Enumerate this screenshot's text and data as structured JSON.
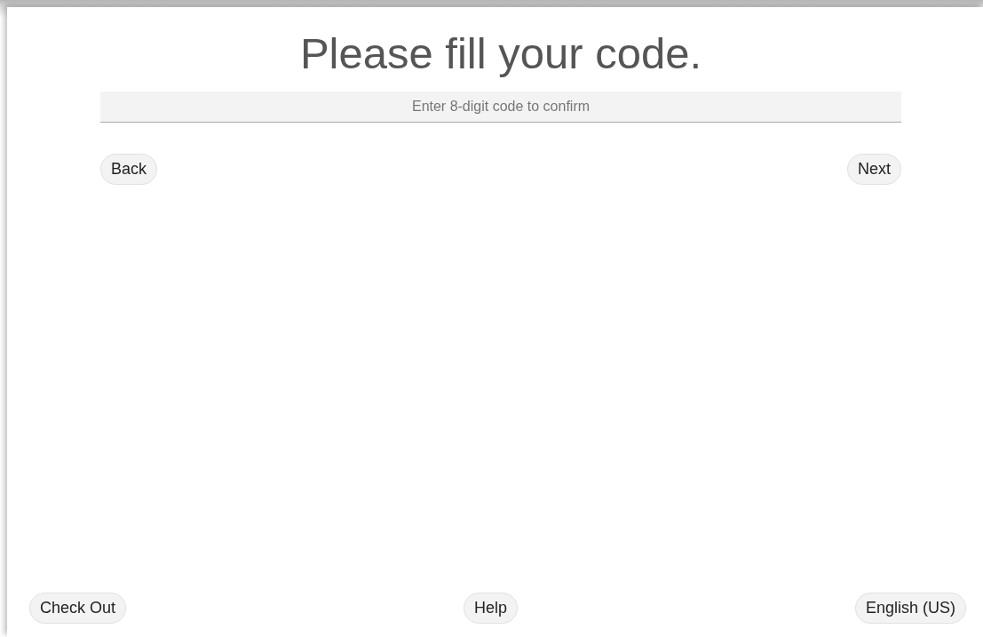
{
  "title": "Please fill your code.",
  "code_field": {
    "placeholder": "Enter 8-digit code to confirm"
  },
  "nav_buttons": [
    {
      "label": "Back"
    },
    {
      "label": "Next"
    }
  ],
  "footer_buttons": [
    {
      "label": "Check Out"
    },
    {
      "label": "Help"
    },
    {
      "label": "English (US)"
    }
  ]
}
